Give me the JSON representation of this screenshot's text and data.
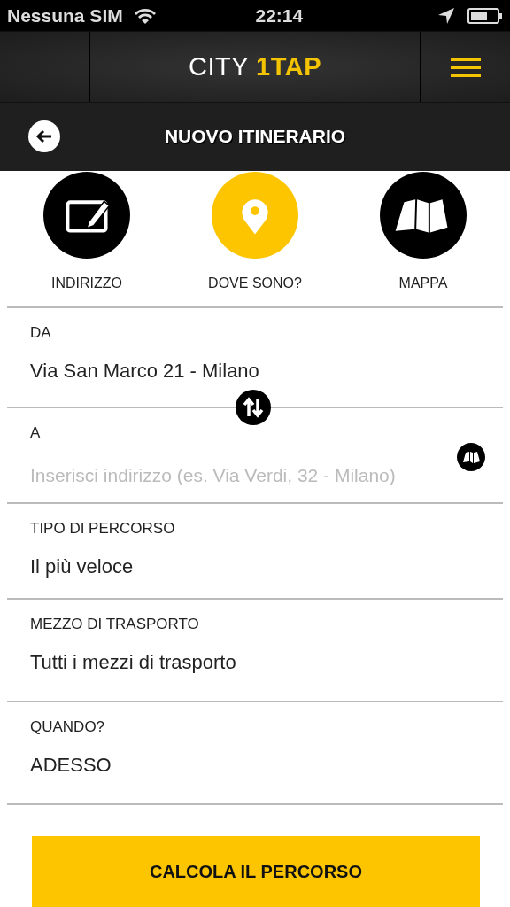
{
  "status_bar": {
    "carrier": "Nessuna SIM",
    "time": "22:14"
  },
  "header": {
    "brand": "CITY",
    "brand_accent": "1TAP"
  },
  "subheader": {
    "title": "NUOVO ITINERARIO"
  },
  "quick_actions": [
    {
      "kind": "edit",
      "label": "INDIRIZZO",
      "selected": false
    },
    {
      "kind": "pin",
      "label": "DOVE SONO?",
      "selected": true
    },
    {
      "kind": "map",
      "label": "MAPPA",
      "selected": false
    }
  ],
  "fields": [
    {
      "kind": "value",
      "label": "DA",
      "value": "Via San Marco 21 - Milano"
    },
    {
      "kind": "input",
      "label": "A",
      "placeholder": "Inserisci indirizzo (es. Via Verdi, 32 - Milano)"
    },
    {
      "kind": "value",
      "label": "TIPO DI PERCORSO",
      "value": "Il più veloce"
    },
    {
      "kind": "value",
      "label": "MEZZO DI TRASPORTO",
      "value": "Tutti i mezzi di trasporto"
    },
    {
      "kind": "value",
      "label": "QUANDO?",
      "value": "ADESSO"
    }
  ],
  "submit_button": "CALCOLA IL PERCORSO"
}
